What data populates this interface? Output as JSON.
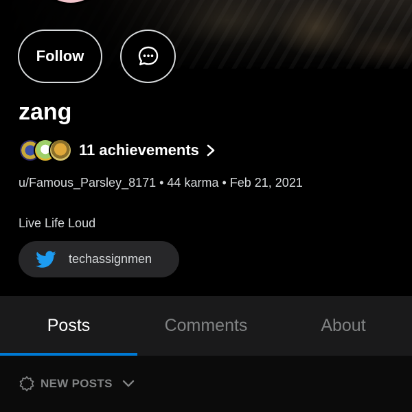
{
  "profile": {
    "display_name": "zang",
    "achievements_label": "11 achievements",
    "meta_line": "u/Famous_Parsley_8171 • 44 karma • Feb 21, 2021",
    "bio": "Live Life Loud",
    "social_link": {
      "platform_icon": "twitter-icon",
      "handle": "techassignmen"
    }
  },
  "actions": {
    "follow_label": "Follow",
    "chat_icon": "chat-bubble-icon"
  },
  "tabs": [
    {
      "label": "Posts",
      "active": true
    },
    {
      "label": "Comments",
      "active": false
    },
    {
      "label": "About",
      "active": false
    }
  ],
  "sort": {
    "label": "NEW POSTS",
    "icon": "new-burst-icon"
  },
  "colors": {
    "accent": "#0079d3",
    "twitter": "#1d9bf0",
    "background": "#000000",
    "tab_bar": "#1a1a1b",
    "muted_text": "#818384"
  }
}
